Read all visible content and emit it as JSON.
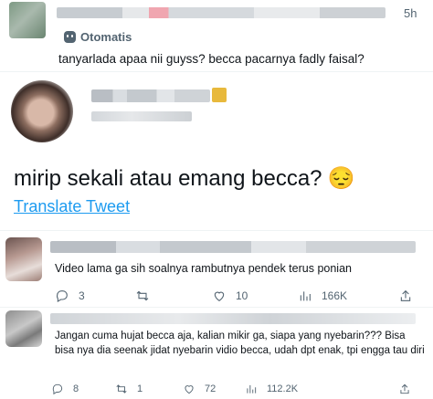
{
  "context_post": {
    "time": "5h",
    "auto_label": "Otomatis",
    "text": "tanyarlada apaa nii guyss? becca pacarnya fadly faisal?"
  },
  "main_post": {
    "text": "mirip sekali atau emang becca?",
    "emoji": "😔",
    "translate_label": "Translate Tweet"
  },
  "replies": [
    {
      "text": "Video lama ga sih soalnya rambutnya pendek terus ponian",
      "reply_count": "3",
      "retweet_count": "",
      "like_count": "10",
      "view_count": "166K"
    },
    {
      "text": "Jangan cuma hujat becca aja, kalian mikir ga, siapa yang nyebarin??? Bisa bisa nya dia seenak jidat nyebarin vidio becca, udah dpt enak, tpi engga tau diri",
      "reply_count": "8",
      "retweet_count": "1",
      "like_count": "72",
      "view_count": "112.2K"
    }
  ],
  "colors": {
    "link": "#1d9bf0",
    "muted": "#536471",
    "text": "#0f1419"
  }
}
